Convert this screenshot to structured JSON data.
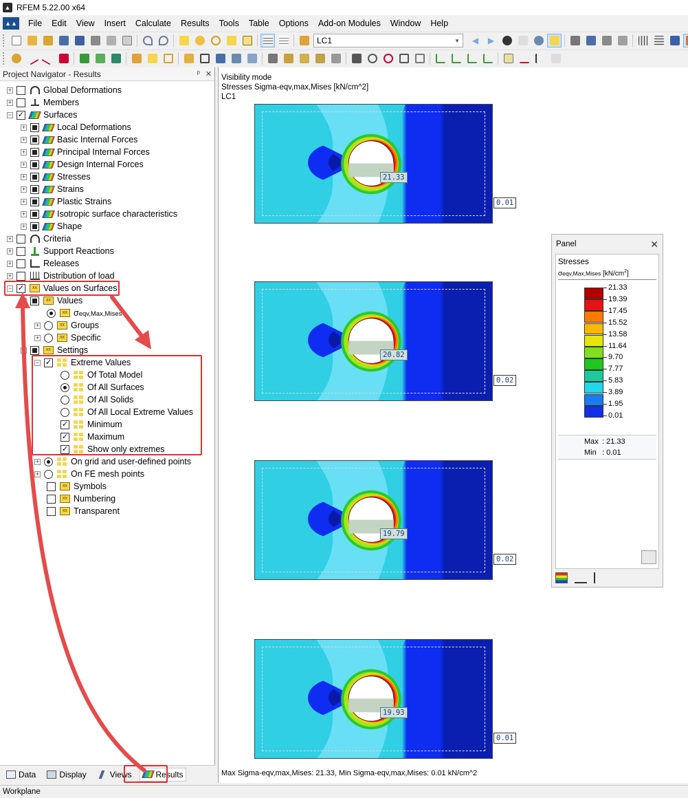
{
  "window": {
    "title": "RFEM 5.22.00 x64"
  },
  "menu": [
    "File",
    "Edit",
    "View",
    "Insert",
    "Calculate",
    "Results",
    "Tools",
    "Table",
    "Options",
    "Add-on Modules",
    "Window",
    "Help"
  ],
  "toolbar": {
    "load_case": "LC1"
  },
  "navigator": {
    "title": "Project Navigator - Results",
    "items": {
      "global_deformations": "Global Deformations",
      "members": "Members",
      "surfaces": "Surfaces",
      "local_deformations": "Local Deformations",
      "basic_internal_forces": "Basic Internal Forces",
      "principal_internal_forces": "Principal Internal Forces",
      "design_internal_forces": "Design Internal Forces",
      "stresses": "Stresses",
      "strains": "Strains",
      "plastic_strains": "Plastic Strains",
      "isotropic": "Isotropic surface characteristics",
      "shape": "Shape",
      "criteria": "Criteria",
      "support_reactions": "Support Reactions",
      "releases": "Releases",
      "distribution_of_load": "Distribution of load",
      "values_on_surfaces": "Values on Surfaces",
      "values": "Values",
      "sigma_main": "σ",
      "sigma_sub": "eqv,Max,Mises",
      "groups": "Groups",
      "specific": "Specific",
      "settings": "Settings",
      "extreme_values": "Extreme Values",
      "of_total_model": "Of Total Model",
      "of_all_surfaces": "Of All Surfaces",
      "of_all_solids": "Of All Solids",
      "of_all_local_extreme": "Of All Local Extreme Values",
      "minimum": "Minimum",
      "maximum": "Maximum",
      "show_only_extremes": "Show only extremes",
      "on_grid": "On grid and user-defined points",
      "on_fe_mesh": "On FE mesh points",
      "symbols": "Symbols",
      "numbering": "Numbering",
      "transparent": "Transparent"
    },
    "tabs": [
      "Data",
      "Display",
      "Views",
      "Results"
    ]
  },
  "view": {
    "info_lines": [
      "Visibility mode",
      "Stresses Sigma-eqv,max,Mises [kN/cm^2]",
      "LC1"
    ],
    "footer": "Max Sigma-eqv,max,Mises: 21.33, Min Sigma-eqv,max,Mises: 0.01 kN/cm^2",
    "plates": [
      {
        "max": "21.33",
        "min": "0.01"
      },
      {
        "max": "20.82",
        "min": "0.02"
      },
      {
        "max": "19.79",
        "min": "0.02"
      },
      {
        "max": "19.93",
        "min": "0.01"
      }
    ]
  },
  "panel": {
    "title": "Panel",
    "section": "Stresses",
    "subtitle_main": "σ",
    "subtitle_sub": "eqv,Max,Mises",
    "subtitle_unit": " [kN/cm",
    "subtitle_exp": "2",
    "subtitle_end": "]",
    "scale_values": [
      "21.33",
      "19.39",
      "17.45",
      "15.52",
      "13.58",
      "11.64",
      "9.70",
      "7.77",
      "5.83",
      "3.89",
      "1.95",
      "0.01"
    ],
    "scale_colors": [
      "#b00000",
      "#e81212",
      "#ff7a00",
      "#ffb800",
      "#e6e60a",
      "#7ee01e",
      "#1ec81e",
      "#1ec8a0",
      "#20d8e8",
      "#1a7cf0",
      "#1230e8",
      "#0a1aa8"
    ],
    "max_label": "Max",
    "max_value": "21.33",
    "min_label": "Min",
    "min_value": "0.01"
  },
  "status": {
    "text": "Workplane"
  },
  "colors": {
    "highlight": "#e0312f",
    "nav_bg": "#ffffff",
    "chrome": "#f0f0f0"
  }
}
